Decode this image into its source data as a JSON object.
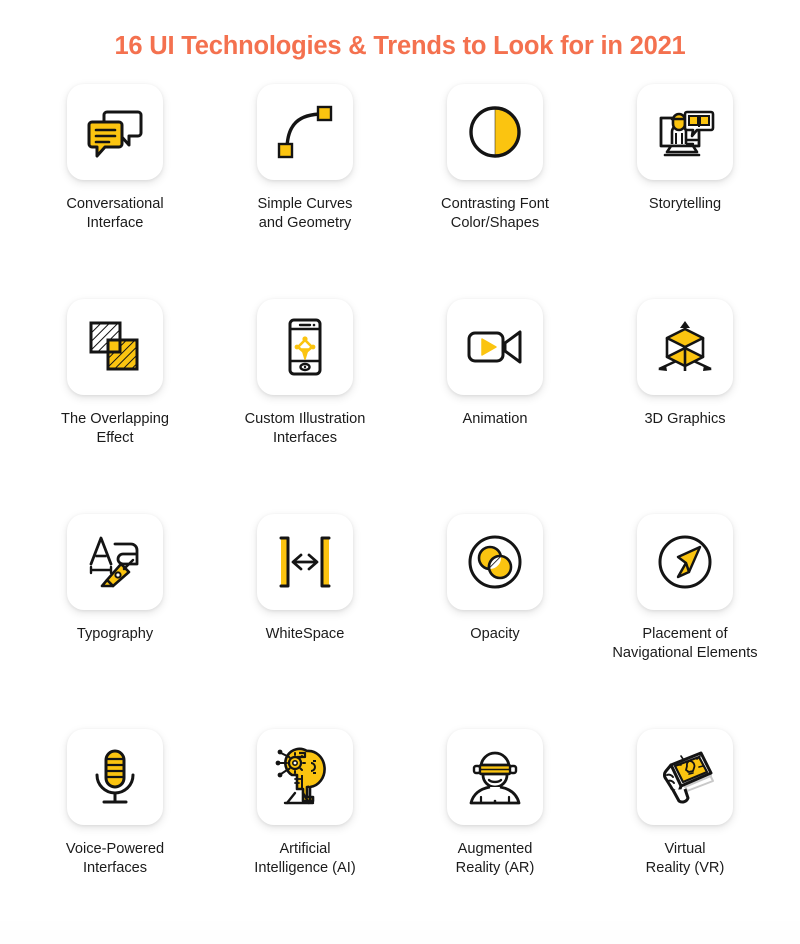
{
  "page": {
    "title": "16 UI Technologies & Trends to Look for in 2021",
    "background_color": "#FFFFFF",
    "title_color": "#F4714F",
    "accent_color": "#FBC410",
    "line_color": "#141414",
    "caption_color": "#1B1B1B"
  },
  "items": [
    {
      "icon": "speech-bubbles-icon",
      "label": "Conversational\nInterface",
      "line1": "Conversational",
      "line2": "Interface"
    },
    {
      "icon": "bezier-curve-icon",
      "label": "Simple Curves\nand Geometry",
      "line1": "Simple Curves",
      "line2": "and Geometry"
    },
    {
      "icon": "half-filled-circle-icon",
      "label": "Contrasting Font\nColor/Shapes",
      "line1": "Contrasting Font",
      "line2": "Color/Shapes"
    },
    {
      "icon": "monitor-storytelling-icon",
      "label": "Storytelling",
      "line1": "Storytelling",
      "line2": ""
    },
    {
      "icon": "overlapping-squares-icon",
      "label": "The Overlapping\nEffect",
      "line1": "The Overlapping",
      "line2": "Effect"
    },
    {
      "icon": "smartphone-pen-tool-icon",
      "label": "Custom Illustration\nInterfaces",
      "line1": "Custom Illustration",
      "line2": "Interfaces"
    },
    {
      "icon": "video-camera-play-icon",
      "label": "Animation",
      "line1": "Animation",
      "line2": ""
    },
    {
      "icon": "isometric-cube-axes-icon",
      "label": "3D Graphics",
      "line1": "3D Graphics",
      "line2": ""
    },
    {
      "icon": "typography-pen-nib-icon",
      "label": "Typography",
      "line1": "Typography",
      "line2": ""
    },
    {
      "icon": "brackets-arrow-icon",
      "label": "WhiteSpace",
      "line1": "WhiteSpace",
      "line2": ""
    },
    {
      "icon": "overlapping-circles-icon",
      "label": "Opacity",
      "line1": "Opacity",
      "line2": ""
    },
    {
      "icon": "navigation-arrow-icon",
      "label": "Placement of\nNavigational Elements",
      "line1": "Placement of",
      "line2": "Navigational Elements"
    },
    {
      "icon": "microphone-icon",
      "label": "Voice-Powered\nInterfaces",
      "line1": "Voice-Powered",
      "line2": "Interfaces"
    },
    {
      "icon": "ai-head-gear-icon",
      "label": "Artificial\nIntelligence (AI)",
      "line1": "Artificial",
      "line2": "Intelligence (AI)"
    },
    {
      "icon": "ar-glasses-person-icon",
      "label": "Augmented\nReality (AR)",
      "line1": "Augmented",
      "line2": "Reality (AR)"
    },
    {
      "icon": "hand-tablet-vr-icon",
      "label": "Virtual\nReality (VR)",
      "line1": "Virtual",
      "line2": "Reality (VR)"
    }
  ]
}
